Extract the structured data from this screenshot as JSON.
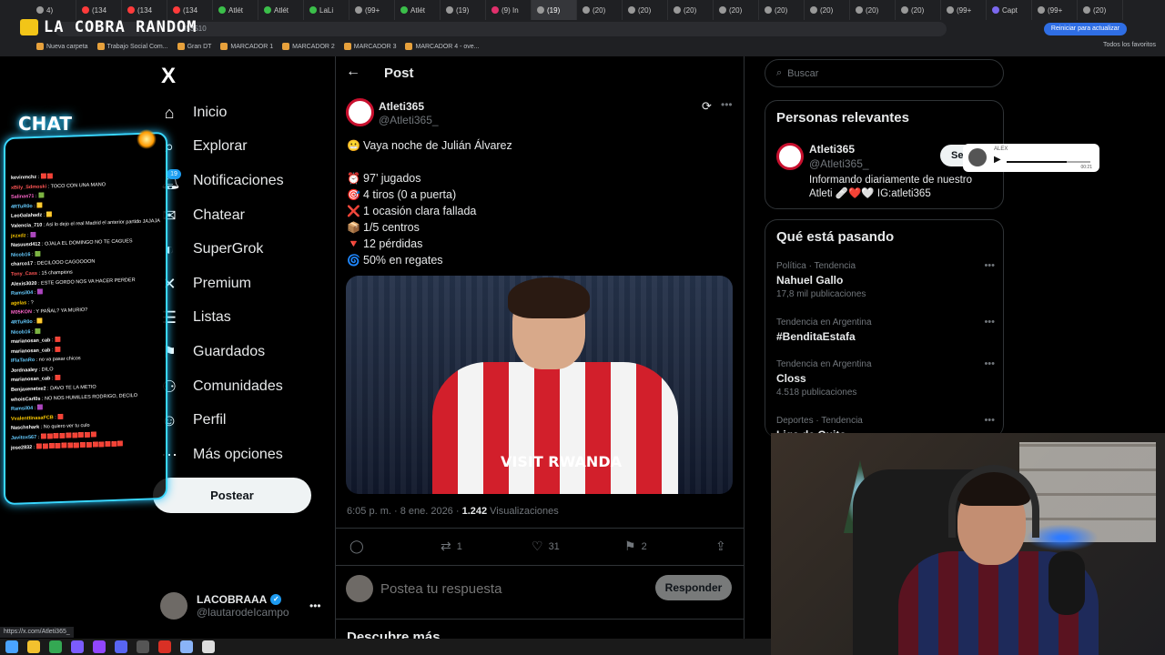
{
  "browser": {
    "tabs": [
      {
        "label": "4)",
        "color": "#999"
      },
      {
        "label": "(134",
        "color": "#ff3b3b"
      },
      {
        "label": "(134",
        "color": "#ff3b3b"
      },
      {
        "label": "(134",
        "color": "#ff3b3b"
      },
      {
        "label": "Atlét",
        "color": "#3bbf4a"
      },
      {
        "label": "Atlét",
        "color": "#3bbf4a"
      },
      {
        "label": "LaLi",
        "color": "#3bbf4a"
      },
      {
        "label": "(99+",
        "color": "#999"
      },
      {
        "label": "Atlét",
        "color": "#3bbf4a"
      },
      {
        "label": "(19)",
        "color": "#999"
      },
      {
        "label": "(9) In",
        "color": "#e1306c"
      },
      {
        "label": "(19)",
        "color": "#999",
        "active": true
      },
      {
        "label": "(20)",
        "color": "#999"
      },
      {
        "label": "(20)",
        "color": "#999"
      },
      {
        "label": "(20)",
        "color": "#999"
      },
      {
        "label": "(20)",
        "color": "#999"
      },
      {
        "label": "(20)",
        "color": "#999"
      },
      {
        "label": "(20)",
        "color": "#999"
      },
      {
        "label": "(20)",
        "color": "#999"
      },
      {
        "label": "(20)",
        "color": "#999"
      },
      {
        "label": "(99+",
        "color": "#999"
      },
      {
        "label": "Capt",
        "color": "#7b68ee"
      },
      {
        "label": "(99+",
        "color": "#999"
      },
      {
        "label": "(20)",
        "color": "#999"
      }
    ],
    "address_tail": "353510",
    "update_button": "Reiniciar para actualizar",
    "bookmarks": [
      "Nueva carpeta",
      "Trabajo Social Com...",
      "Gran DT",
      "MARCADOR 1",
      "MARCADOR 2",
      "MARCADOR 3",
      "MARCADOR 4 - ove..."
    ],
    "all_bookmarks": "Todos los favoritos",
    "status_url": "https://x.com/Atleti365_"
  },
  "stream": {
    "logo_text": "LA COBRA RANDOM",
    "chat_title": "CHAT",
    "chat_lines": [
      {
        "user": "kevinmchz",
        "color": "#ffffff",
        "msg": "🟥🟥"
      },
      {
        "user": "xBily_Sdmoski",
        "color": "#ff5555",
        "msg": "TOCO CON UNA MANO"
      },
      {
        "user": "Salinas71",
        "color": "#ff66cc",
        "msg": "🟩"
      },
      {
        "user": "4RTuR0o",
        "color": "#66ccff",
        "msg": "🟨"
      },
      {
        "user": "LeoGalahadz",
        "color": "#ffffff",
        "msg": "🟨"
      },
      {
        "user": "Valencia_710",
        "color": "#ffffff",
        "msg": "Asi lo dejo el real Madrid el anterior partido JAJAJA"
      },
      {
        "user": "jxzxdz",
        "color": "#ffcc00",
        "msg": "🟪"
      },
      {
        "user": "Nasuusd412",
        "color": "#ffffff",
        "msg": "OJALA EL DOMINGO NO TE CAGUES"
      },
      {
        "user": "Nicob16",
        "color": "#66ccff",
        "msg": "🟩"
      },
      {
        "user": "charco17",
        "color": "#ffffff",
        "msg": "DECILOOO CAGOOOON"
      },
      {
        "user": "Tony_Cass",
        "color": "#ff5555",
        "msg": "15 champions"
      },
      {
        "user": "Alexis3020",
        "color": "#ffffff",
        "msg": "ESTE GORDO NOS VA HACER PERDER"
      },
      {
        "user": "Ramsil04",
        "color": "#66ccff",
        "msg": "🟪"
      },
      {
        "user": "agelas",
        "color": "#ffcc00",
        "msg": "?"
      },
      {
        "user": "M05KON",
        "color": "#ff66cc",
        "msg": "Y PAÑAL? YA MURIO?"
      },
      {
        "user": "4RTuR0o",
        "color": "#66ccff",
        "msg": "🟨"
      },
      {
        "user": "Nicob16",
        "color": "#66ccff",
        "msg": "🟩"
      },
      {
        "user": "marianosan_cab",
        "color": "#ffffff",
        "msg": "🟥"
      },
      {
        "user": "marianosan_cab",
        "color": "#ffffff",
        "msg": "🟥"
      },
      {
        "user": "IFlaTanRo",
        "color": "#66ccff",
        "msg": "no va pasar chicos"
      },
      {
        "user": "Jordnaaley",
        "color": "#ffffff",
        "msg": "DILO"
      },
      {
        "user": "marianosan_cab",
        "color": "#ffffff",
        "msg": "🟥"
      },
      {
        "user": "Benjaxenetxe2",
        "color": "#ffffff",
        "msg": "DAVO TE LA METIO"
      },
      {
        "user": "whoisCarl0s",
        "color": "#ffffff",
        "msg": "NO NOS HUMILLES RODRIGO, DECILO"
      },
      {
        "user": "Ramsil04",
        "color": "#66ccff",
        "msg": "🟪"
      },
      {
        "user": "VvalenttinasaFCB",
        "color": "#ffcc00",
        "msg": "🟥"
      },
      {
        "user": "Naschshark",
        "color": "#ffffff",
        "msg": "No quiero ver tu culo"
      },
      {
        "user": "Javitox567",
        "color": "#66ccff",
        "msg": "🟥🟥🟥🟥🟥🟥🟥🟥🟥"
      },
      {
        "user": "jose2832",
        "color": "#ffffff",
        "msg": "🟥🟥🟥🟥🟥🟥🟥🟥🟥🟥🟥🟥🟥🟥"
      }
    ]
  },
  "nav": {
    "logo": "X",
    "notification_count": "19",
    "items": [
      {
        "label": "Inicio",
        "icon": "home-icon",
        "glyph": "⌂"
      },
      {
        "label": "Explorar",
        "icon": "search-icon",
        "glyph": "⌕"
      },
      {
        "label": "Notificaciones",
        "icon": "bell-icon",
        "glyph": "🔔︎"
      },
      {
        "label": "Chatear",
        "icon": "mail-icon",
        "glyph": "✉"
      },
      {
        "label": "SuperGrok",
        "icon": "grok-icon",
        "glyph": "◐"
      },
      {
        "label": "Premium",
        "icon": "x-premium-icon",
        "glyph": "✕"
      },
      {
        "label": "Listas",
        "icon": "list-icon",
        "glyph": "☰"
      },
      {
        "label": "Guardados",
        "icon": "bookmark-icon",
        "glyph": "⚑"
      },
      {
        "label": "Comunidades",
        "icon": "communities-icon",
        "glyph": "⚇"
      },
      {
        "label": "Perfil",
        "icon": "profile-icon",
        "glyph": "☺"
      },
      {
        "label": "Más opciones",
        "icon": "more-icon",
        "glyph": "⋯"
      }
    ],
    "post_button": "Postear",
    "account": {
      "name": "LACOBRAAA",
      "handle": "@lautarodeIcampo"
    }
  },
  "post": {
    "header_title": "Post",
    "author_name": "Atleti365",
    "author_handle": "@Atleti365_",
    "lines": [
      {
        "emoji": "😬",
        "text": "Vaya noche de Julián Álvarez"
      },
      {
        "gap": true
      },
      {
        "emoji": "⏰",
        "text": "97’ jugados"
      },
      {
        "emoji": "🎯",
        "text": "4 tiros (0 a puerta)"
      },
      {
        "emoji": "❌",
        "text": "1 ocasión clara fallada"
      },
      {
        "emoji": "📦",
        "text": "1/5 centros"
      },
      {
        "emoji": "🔻",
        "text": "12 pérdidas"
      },
      {
        "emoji": "🌀",
        "text": "50% en regates"
      }
    ],
    "shirt_text": "VISIT RWANDA",
    "timestamp": "6:05 p. m. · 8 ene. 2026 · ",
    "views": "1.242",
    "views_label": " Visualizaciones",
    "actions": {
      "replies": "",
      "reposts": "1",
      "likes": "31",
      "bookmarks": "2"
    },
    "reply_placeholder": "Postea tu respuesta",
    "reply_button": "Responder",
    "discover": "Descubre más"
  },
  "sidebar": {
    "search_placeholder": "Buscar",
    "relevant_title": "Personas relevantes",
    "relevant": {
      "name": "Atleti365",
      "handle": "@Atleti365_",
      "bio": "Informando diariamente de nuestro Atleti 🩹❤️🤍 IG:atleti365",
      "follow": "Se"
    },
    "trends_title": "Qué está pasando",
    "trends": [
      {
        "category": "Política · Tendencia",
        "name": "Nahuel Gallo",
        "count": "17,8 mil publicaciones"
      },
      {
        "category": "Tendencia en Argentina",
        "name": "#BenditaEstafa",
        "count": ""
      },
      {
        "category": "Tendencia en Argentina",
        "name": "Closs",
        "count": "4.518 publicaciones"
      },
      {
        "category": "Deportes · Tendencia",
        "name": "Liga de Quito",
        "count": ""
      }
    ]
  },
  "audio": {
    "name": "ALEX",
    "time": "00:21",
    "progress": 0.72
  }
}
